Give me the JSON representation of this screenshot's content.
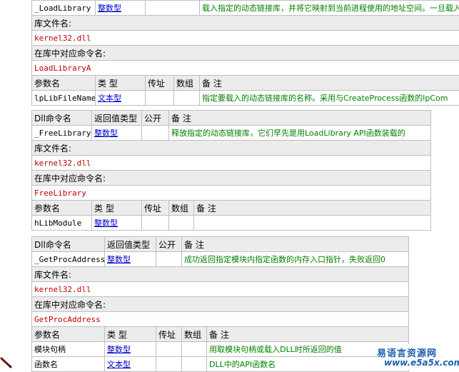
{
  "block1": {
    "top_row": {
      "name": "_LoadLibrary",
      "type": "整数型",
      "note": "载入指定的动态链接库，并将它映射到当前进程使用的地址空间。一旦载入"
    },
    "lib_label": "库文件名:",
    "lib_value": "kernel32.dll",
    "cmd_label": "在库中对应命令名:",
    "cmd_value": "LoadLibraryA",
    "param_headers": [
      "参数名",
      "类 型",
      "传址",
      "数组",
      "备 注"
    ],
    "params": [
      {
        "name": "lpLibFileName",
        "type": "文本型",
        "byref": "",
        "array": "",
        "note": "指定要载入的动态链接库的名称。采用与CreateProcess函数的lpCom"
      }
    ]
  },
  "block2": {
    "headers": [
      "Dll命令名",
      "返回值类型",
      "公开",
      "备 注"
    ],
    "top_row": {
      "name": "_FreeLibrary",
      "type": "整数型",
      "public": "",
      "note": "释放指定的动态链接库，它们早先是用LoadLibrary API函数装载的"
    },
    "lib_label": "库文件名:",
    "lib_value": "kernel32.dll",
    "cmd_label": "在库中对应命令名:",
    "cmd_value": "FreeLibrary",
    "param_headers": [
      "参数名",
      "类 型",
      "传址",
      "数组",
      "备 注"
    ],
    "params": [
      {
        "name": "hLibModule",
        "type": "整数型",
        "byref": "",
        "array": "",
        "note": ""
      }
    ]
  },
  "block3": {
    "headers": [
      "Dll命令名",
      "返回值类型",
      "公开",
      "备 注"
    ],
    "top_row": {
      "name": "_GetProcAddress",
      "type": "整数型",
      "public": "",
      "note": "成功返回指定模块内指定函数的内存入口指针，失败返回0"
    },
    "lib_label": "库文件名:",
    "lib_value": "kernel32.dll",
    "cmd_label": "在库中对应命令名:",
    "cmd_value": "GetProcAddress",
    "param_headers": [
      "参数名",
      "类 型",
      "传址",
      "数组",
      "备 注"
    ],
    "params": [
      {
        "name": "模块句柄",
        "type": "整数型",
        "byref": "",
        "array": "",
        "note": "用取模块句柄或载入DLL时所返回的值"
      },
      {
        "name": "函数名",
        "type": "文本型",
        "byref": "",
        "array": "",
        "note": "DLL中的API函数名"
      }
    ]
  },
  "watermark": {
    "cn": "易语言资源网",
    "en": "www.e5a5x.com"
  }
}
